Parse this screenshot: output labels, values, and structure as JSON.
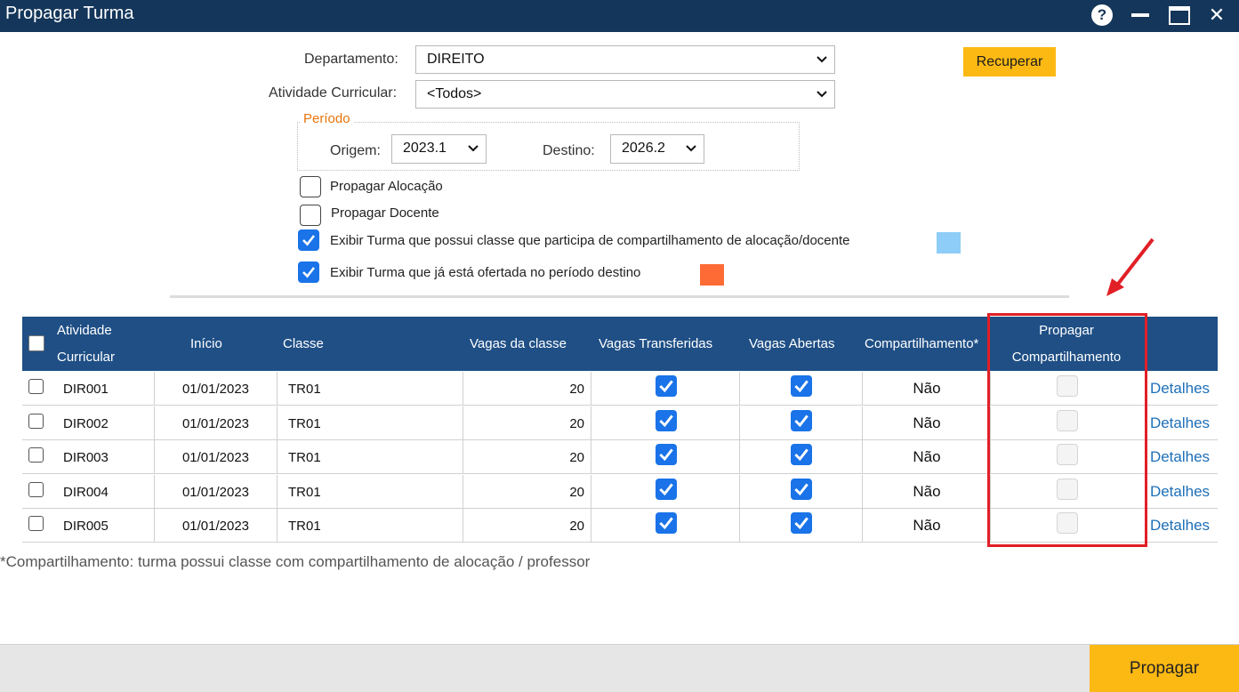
{
  "window": {
    "title": "Propagar Turma",
    "help_glyph": "?",
    "close_glyph": "✕"
  },
  "form": {
    "departamento_label": "Departamento:",
    "departamento_value": "DIREITO",
    "atividade_label": "Atividade Curricular:",
    "atividade_value": "<Todos>",
    "recuperar_label": "Recuperar",
    "periodo_legend": "Período",
    "origem_label": "Origem:",
    "origem_value": "2023.1",
    "destino_label": "Destino:",
    "destino_value": "2026.2"
  },
  "options": [
    {
      "label": "Propagar Alocação",
      "checked": false
    },
    {
      "label": "Propagar Docente",
      "checked": false
    },
    {
      "label": "Exibir Turma que possui classe que participa de compartilhamento de alocação/docente",
      "checked": true,
      "swatch": "#8ecdf7"
    },
    {
      "label": "Exibir Turma que já está ofertada no período destino",
      "checked": true,
      "swatch": "#ff6b35"
    }
  ],
  "table": {
    "headers": {
      "atividade_1": "Atividade",
      "atividade_2": "Curricular",
      "inicio": "Início",
      "classe": "Classe",
      "vagas_classe": "Vagas da classe",
      "vagas_transferidas": "Vagas Transferidas",
      "vagas_abertas": "Vagas Abertas",
      "compartilhamento": "Compartilhamento*",
      "propagar_1": "Propagar",
      "propagar_2": "Compartilhamento"
    },
    "rows": [
      {
        "atividade": "DIR001",
        "inicio": "01/01/2023",
        "classe": "TR01",
        "vagas": "20",
        "transferidas": true,
        "abertas": true,
        "compartilhamento": "Não",
        "detalhes": "Detalhes"
      },
      {
        "atividade": "DIR002",
        "inicio": "01/01/2023",
        "classe": "TR01",
        "vagas": "20",
        "transferidas": true,
        "abertas": true,
        "compartilhamento": "Não",
        "detalhes": "Detalhes"
      },
      {
        "atividade": "DIR003",
        "inicio": "01/01/2023",
        "classe": "TR01",
        "vagas": "20",
        "transferidas": true,
        "abertas": true,
        "compartilhamento": "Não",
        "detalhes": "Detalhes"
      },
      {
        "atividade": "DIR004",
        "inicio": "01/01/2023",
        "classe": "TR01",
        "vagas": "20",
        "transferidas": true,
        "abertas": true,
        "compartilhamento": "Não",
        "detalhes": "Detalhes"
      },
      {
        "atividade": "DIR005",
        "inicio": "01/01/2023",
        "classe": "TR01",
        "vagas": "20",
        "transferidas": true,
        "abertas": true,
        "compartilhamento": "Não",
        "detalhes": "Detalhes"
      }
    ]
  },
  "footnote": "*Compartilhamento: turma possui classe com compartilhamento de alocação / professor",
  "footer": {
    "propagar_label": "Propagar"
  },
  "colors": {
    "titlebar": "#14365a",
    "table_header": "#1f4f85",
    "accent": "#fdb913",
    "highlight": "#e11f26",
    "checkbox": "#1a73e8",
    "legend": "#e8740c"
  }
}
